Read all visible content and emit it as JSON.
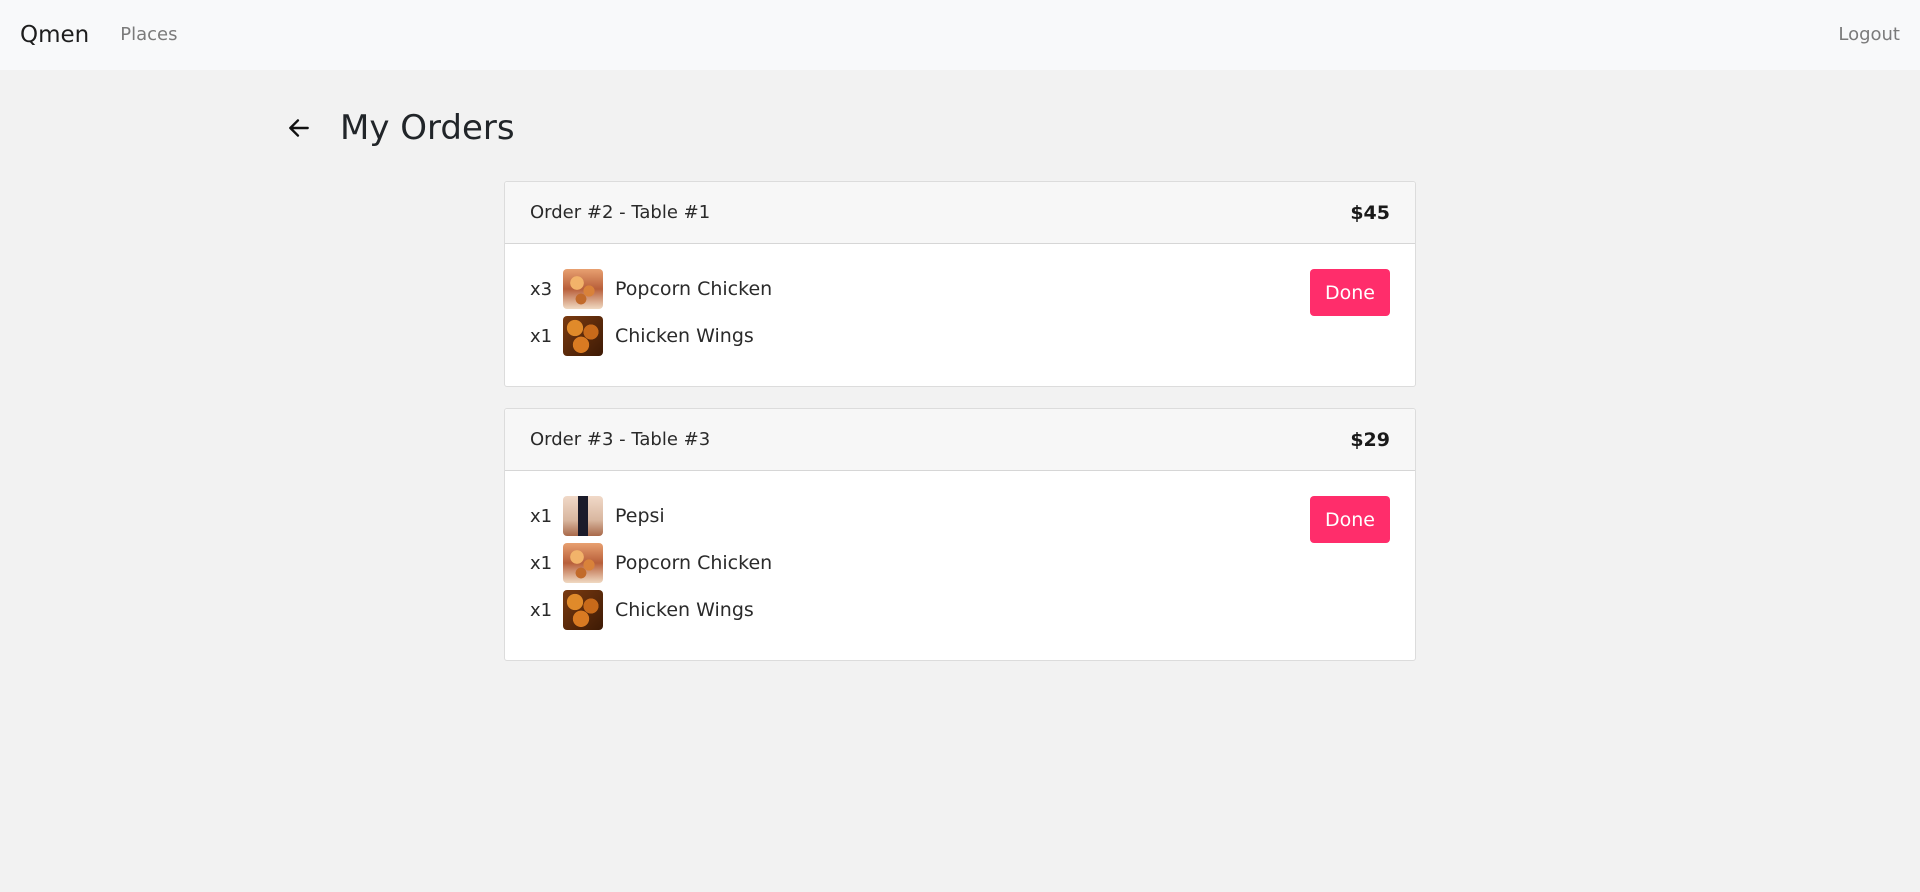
{
  "navbar": {
    "brand": "Qmen",
    "places_label": "Places",
    "logout_label": "Logout"
  },
  "page": {
    "title": "My Orders",
    "back_icon": "arrow-left-icon"
  },
  "orders": [
    {
      "title": "Order #2 - Table #1",
      "total": "$45",
      "done_label": "Done",
      "items": [
        {
          "qty": "x3",
          "name": "Popcorn Chicken",
          "icon": "popcorn-chicken-thumbnail"
        },
        {
          "qty": "x1",
          "name": "Chicken Wings",
          "icon": "chicken-wings-thumbnail"
        }
      ]
    },
    {
      "title": "Order #3 - Table #3",
      "total": "$29",
      "done_label": "Done",
      "items": [
        {
          "qty": "x1",
          "name": "Pepsi",
          "icon": "pepsi-thumbnail"
        },
        {
          "qty": "x1",
          "name": "Popcorn Chicken",
          "icon": "popcorn-chicken-thumbnail"
        },
        {
          "qty": "x1",
          "name": "Chicken Wings",
          "icon": "chicken-wings-thumbnail"
        }
      ]
    }
  ],
  "colors": {
    "accent": "#ff2d6b",
    "navbar_bg": "#f8f9fa",
    "page_bg": "#f2f2f2"
  }
}
